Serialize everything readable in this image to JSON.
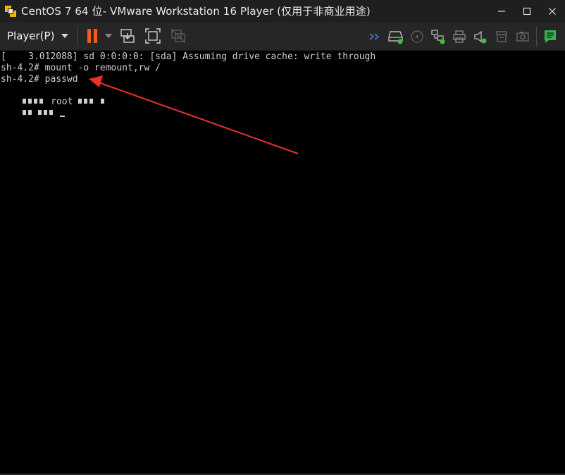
{
  "window": {
    "title": "CentOS 7 64 位- VMware Workstation 16 Player (仅用于非商业用途)",
    "controls": [
      "minimize-icon",
      "maximize-icon",
      "close-icon"
    ]
  },
  "toolbar": {
    "player_menu_label": "Player(P)",
    "left_icons": [
      "pause-icon",
      "dropdown-icon",
      "send-ctrl-alt-del-icon",
      "fullscreen-icon",
      "unity-icon"
    ],
    "right_icons": [
      "chevron-right-icon",
      "hard-disk-icon",
      "cd-icon",
      "network-icon",
      "printer-icon",
      "sound-icon",
      "usb-icon",
      "camera-icon",
      "message-log-icon"
    ],
    "accent_color": "#f25c1b"
  },
  "console": {
    "lines": [
      "[    3.012088] sd 0:0:0:0: [sda] Assuming drive cache: write through",
      "sh-4.2# mount -o remount,rw /",
      "sh-4.2# passwd"
    ],
    "garbled_line_1_word": "root",
    "annotation_color": "#e8322c"
  }
}
